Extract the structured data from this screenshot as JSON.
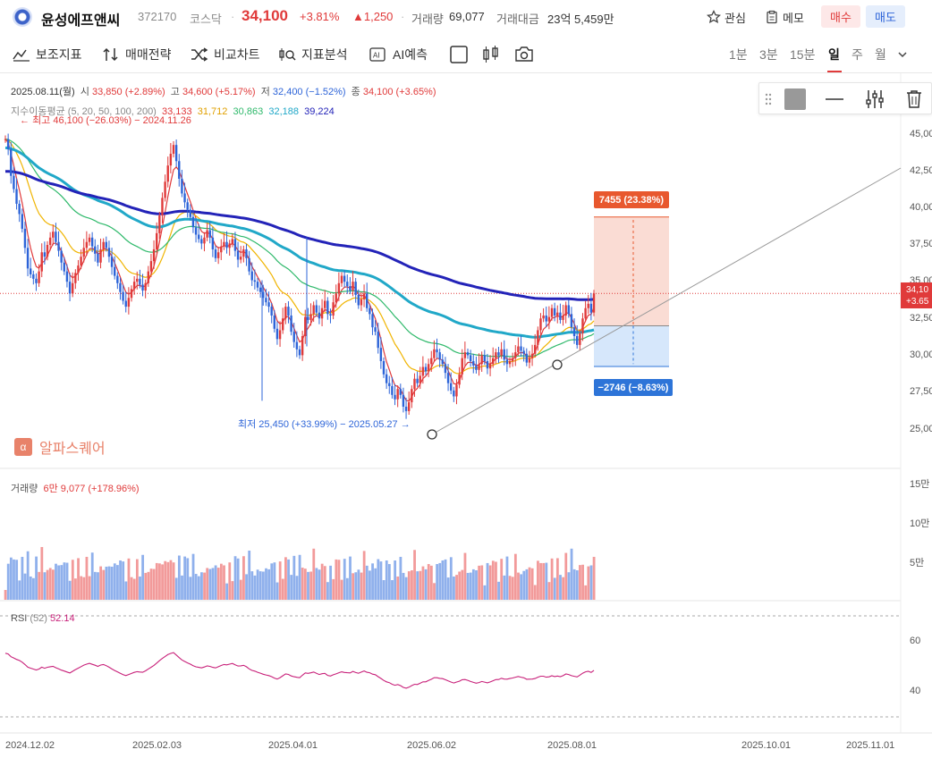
{
  "header": {
    "stock_name": "윤성에프앤씨",
    "stock_code": "372170",
    "market": "코스닥",
    "price": "34,100",
    "change_pct": "+3.81%",
    "change_amount": "▲1,250",
    "volume_label": "거래량",
    "volume_value": "69,077",
    "amount_label": "거래대금",
    "amount_value": "23억 5,459만",
    "watch_label": "관심",
    "memo_label": "메모",
    "buy_label": "매수",
    "sell_label": "매도"
  },
  "toolbar": {
    "indicators": "보조지표",
    "strategy": "매매전략",
    "compare": "비교차트",
    "analysis": "지표분석",
    "ai": "AI예측",
    "timeframes": [
      "1분",
      "3분",
      "15분",
      "일",
      "주",
      "월"
    ],
    "active_timeframe": "일"
  },
  "ohlc": {
    "date": "2025.08.11(월)",
    "open_label": "시",
    "open": "33,850 (+2.89%)",
    "high_label": "고",
    "high": "34,600 (+5.17%)",
    "low_label": "저",
    "low": "32,400 (−1.52%)",
    "close_label": "종",
    "close": "34,100 (+3.65%)"
  },
  "ma": {
    "label": "지수이동평균 (5, 20, 50, 100, 200)",
    "values": [
      "33,133",
      "31,712",
      "30,863",
      "32,188",
      "39,224"
    ],
    "colors": [
      "#e0383a",
      "#f0b400",
      "#2fb96b",
      "#21a8c8",
      "#2323b8"
    ]
  },
  "annotations": {
    "high_note": "최고 46,100 (−26.03%) − 2024.11.26",
    "low_note": "최저 25,450 (+33.99%) − 2025.05.27",
    "profit_badge": "7455 (23.38%)",
    "loss_badge": "−2746 (−8.63%)",
    "last_price_tag_1": "34,10",
    "last_price_tag_2": "+3.65"
  },
  "price_axis": [
    "45,00",
    "42,50",
    "40,00",
    "37,50",
    "35,00",
    "32,50",
    "30,00",
    "27,50",
    "25,00"
  ],
  "volume": {
    "label": "거래량",
    "value": "6만 9,077 (+178.96%)",
    "axis": [
      "15만",
      "10만",
      "5만"
    ]
  },
  "rsi": {
    "label": "RSI",
    "period": "(52)",
    "value": "52.14",
    "axis": [
      "60",
      "40"
    ]
  },
  "date_axis": [
    "2024.12.02",
    "2025.02.03",
    "2025.04.01",
    "2025.06.02",
    "2025.08.01",
    "2025.10.01",
    "2025.11.01"
  ],
  "brand": "알파스퀘어",
  "brand_symbol": "α",
  "colors": {
    "up": "#e03a3a",
    "down": "#2d64d8",
    "profit_zone": "#f9d6cc",
    "loss_zone": "#cfe3fa"
  },
  "chart_data": {
    "type": "candlestick",
    "ylim": [
      24000,
      46500
    ],
    "close": [
      44600,
      43900,
      42100,
      41200,
      40200,
      39500,
      38500,
      37200,
      35800,
      35400,
      35100,
      34800,
      35600,
      36900,
      36600,
      37400,
      37900,
      38300,
      37600,
      37000,
      36200,
      35600,
      34900,
      34100,
      34800,
      35500,
      36000,
      36600,
      37200,
      37600,
      37900,
      37300,
      36800,
      36200,
      37100,
      37600,
      37200,
      36600,
      35900,
      35300,
      34800,
      34200,
      33600,
      33200,
      33800,
      34400,
      34900,
      35100,
      34700,
      34300,
      34800,
      35600,
      36300,
      37100,
      38200,
      39400,
      40600,
      41700,
      42800,
      43600,
      44200,
      43100,
      41900,
      40900,
      40300,
      39800,
      39300,
      38600,
      38100,
      37800,
      37500,
      37900,
      38400,
      37900,
      37100,
      36500,
      36900,
      37300,
      37600,
      37200,
      37500,
      37800,
      37000,
      36400,
      36600,
      37100,
      36500,
      35600,
      35000,
      34900,
      34500,
      34200,
      33800,
      33500,
      33200,
      32600,
      31700,
      31000,
      31600,
      32400,
      33200,
      32600,
      31500,
      30800,
      30300,
      29900,
      31200,
      32500,
      32300,
      32700,
      33300,
      32800,
      32400,
      33100,
      33600,
      32700,
      32600,
      33500,
      34100,
      34800,
      35300,
      34900,
      34600,
      34300,
      34900,
      34000,
      33300,
      33700,
      34100,
      33100,
      32700,
      31800,
      31500,
      30400,
      29500,
      28600,
      28000,
      27800,
      27200,
      26900,
      27600,
      27200,
      26400,
      26100,
      26700,
      27600,
      28300,
      28000,
      28500,
      29100,
      28800,
      29300,
      29700,
      30300,
      30100,
      29600,
      29300,
      28700,
      28000,
      27500,
      27100,
      27900,
      28600,
      29700,
      30100,
      29900,
      29500,
      29200,
      28900,
      29300,
      29900,
      29500,
      29000,
      29300,
      29700,
      30100,
      29900,
      30300,
      29600,
      29300,
      29500,
      29700,
      30100,
      30500,
      30200,
      30000,
      29400,
      29700,
      30000,
      30600,
      31600,
      32400,
      32600,
      32200,
      32500,
      33100,
      32600,
      32800,
      32300,
      32600,
      33300,
      32700,
      31800,
      31200,
      30600,
      31400,
      32400,
      33100,
      33400,
      32800,
      34100
    ],
    "ma_periods": [
      5,
      20,
      50,
      100,
      200
    ],
    "volume_unit": "주",
    "rsi_period": 52
  }
}
